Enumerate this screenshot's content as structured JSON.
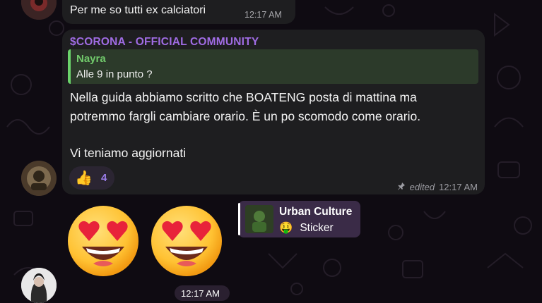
{
  "messages": [
    {
      "text": "Per me so tutti ex calciatori",
      "time": "12:17 AM"
    },
    {
      "sender": "$CORONA - OFFICIAL COMMUNITY",
      "reply": {
        "name": "Nayra",
        "text": "Alle 9 in punto ?"
      },
      "lines": [
        "Nella guida abbiamo scritto che BOATENG posta di mattina ma",
        "potremmo fargli cambiare orario. È un po scomodo come orario.",
        "",
        "Vi teniamo aggiornati"
      ],
      "reaction": {
        "icon": "thumbs-up-icon",
        "emoji": "👍",
        "count": "4"
      },
      "edited_label": "edited",
      "time": "12:17 AM"
    }
  ],
  "emojis": [
    "heart-eyes-icon",
    "heart-eyes-icon"
  ],
  "sticker_reply": {
    "title": "Urban Culture",
    "emoji": "🤑",
    "label": "Sticker"
  },
  "last_time": "12:17 AM",
  "colors": {
    "sender": "#a06ce4",
    "reply_accent": "#6bd46b",
    "reaction_count": "#9b7dea"
  }
}
